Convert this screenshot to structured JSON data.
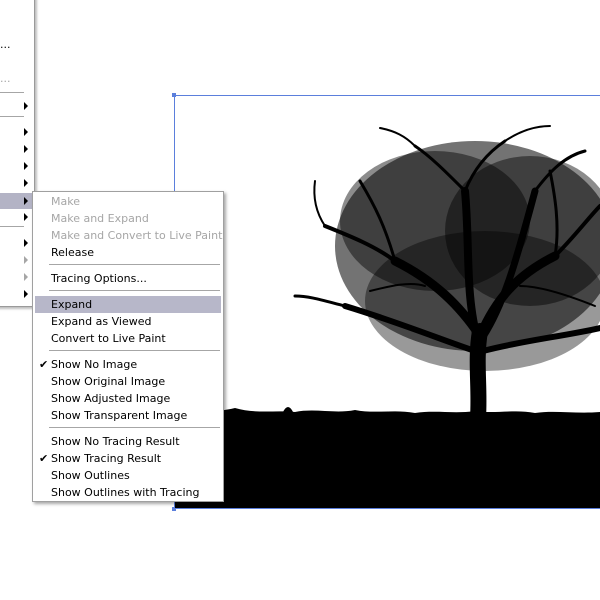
{
  "parent_menu": {
    "partial_items": [
      "...",
      "..."
    ]
  },
  "context_menu": {
    "items": [
      {
        "label": "Make",
        "enabled": false,
        "checked": false
      },
      {
        "label": "Make and Expand",
        "enabled": false,
        "checked": false
      },
      {
        "label": "Make and Convert to Live Paint",
        "enabled": false,
        "checked": false
      },
      {
        "label": "Release",
        "enabled": true,
        "checked": false
      },
      {
        "label": "Tracing Options...",
        "enabled": true,
        "checked": false
      },
      {
        "label": "Expand",
        "enabled": true,
        "checked": false,
        "highlighted": true
      },
      {
        "label": "Expand as Viewed",
        "enabled": true,
        "checked": false
      },
      {
        "label": "Convert to Live Paint",
        "enabled": true,
        "checked": false
      },
      {
        "label": "Show No Image",
        "enabled": true,
        "checked": true
      },
      {
        "label": "Show Original Image",
        "enabled": true,
        "checked": false
      },
      {
        "label": "Show Adjusted Image",
        "enabled": true,
        "checked": false
      },
      {
        "label": "Show Transparent Image",
        "enabled": true,
        "checked": false
      },
      {
        "label": "Show No Tracing Result",
        "enabled": true,
        "checked": false
      },
      {
        "label": "Show Tracing Result",
        "enabled": true,
        "checked": true
      },
      {
        "label": "Show Outlines",
        "enabled": true,
        "checked": false
      },
      {
        "label": "Show Outlines with Tracing",
        "enabled": true,
        "checked": false
      }
    ],
    "check_glyph": "✔"
  },
  "colors": {
    "selection_bounds": "#5b7fdc",
    "menu_highlight": "#b7b7c9",
    "disabled_text": "#a6a6a6"
  }
}
